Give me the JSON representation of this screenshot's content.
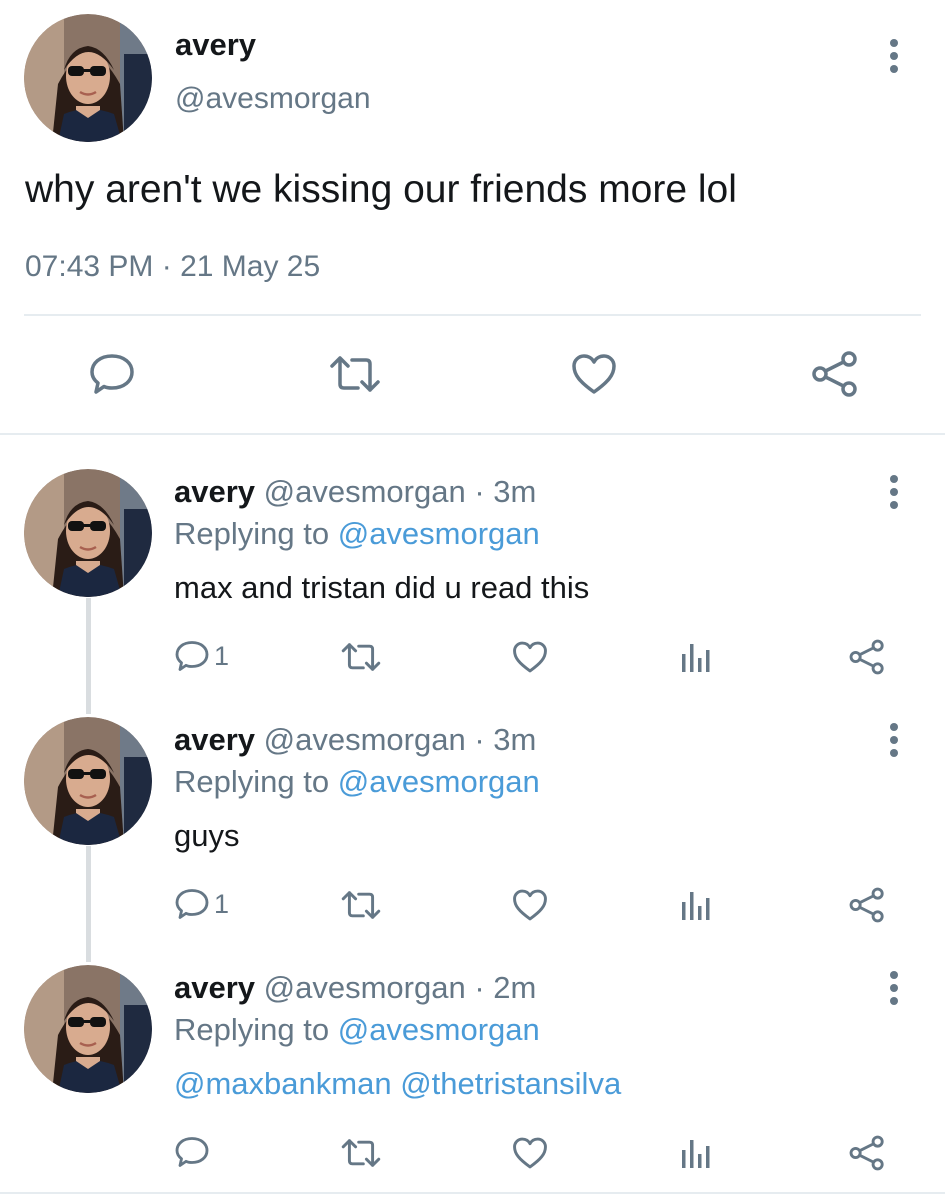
{
  "main_tweet": {
    "display_name": "avery",
    "handle": "@avesmorgan",
    "text": "why aren't we kissing our friends more lol",
    "timestamp": "07:43 PM · 21 May 25",
    "actions": [
      "reply-icon",
      "retweet-icon",
      "like-icon",
      "share-icon"
    ]
  },
  "replies": [
    {
      "display_name": "avery",
      "handle": "@avesmorgan",
      "time": "· 3m",
      "replying_label": "Replying to",
      "replying_to": "@avesmorgan",
      "text": "max and tristan did u read this",
      "reply_count": "1"
    },
    {
      "display_name": "avery",
      "handle": "@avesmorgan",
      "time": "· 3m",
      "replying_label": "Replying to",
      "replying_to": "@avesmorgan",
      "text": "guys",
      "reply_count": "1"
    },
    {
      "display_name": "avery",
      "handle": "@avesmorgan",
      "time": "· 2m",
      "replying_label": "Replying to",
      "replying_to": "@avesmorgan",
      "mention_1": "@maxbankman",
      "mention_2": "@thetristansilva",
      "reply_count": ""
    }
  ],
  "colors": {
    "text": "#14171a",
    "muted": "#657786",
    "link": "#4a9bd8",
    "divider": "#e6ecf0"
  }
}
